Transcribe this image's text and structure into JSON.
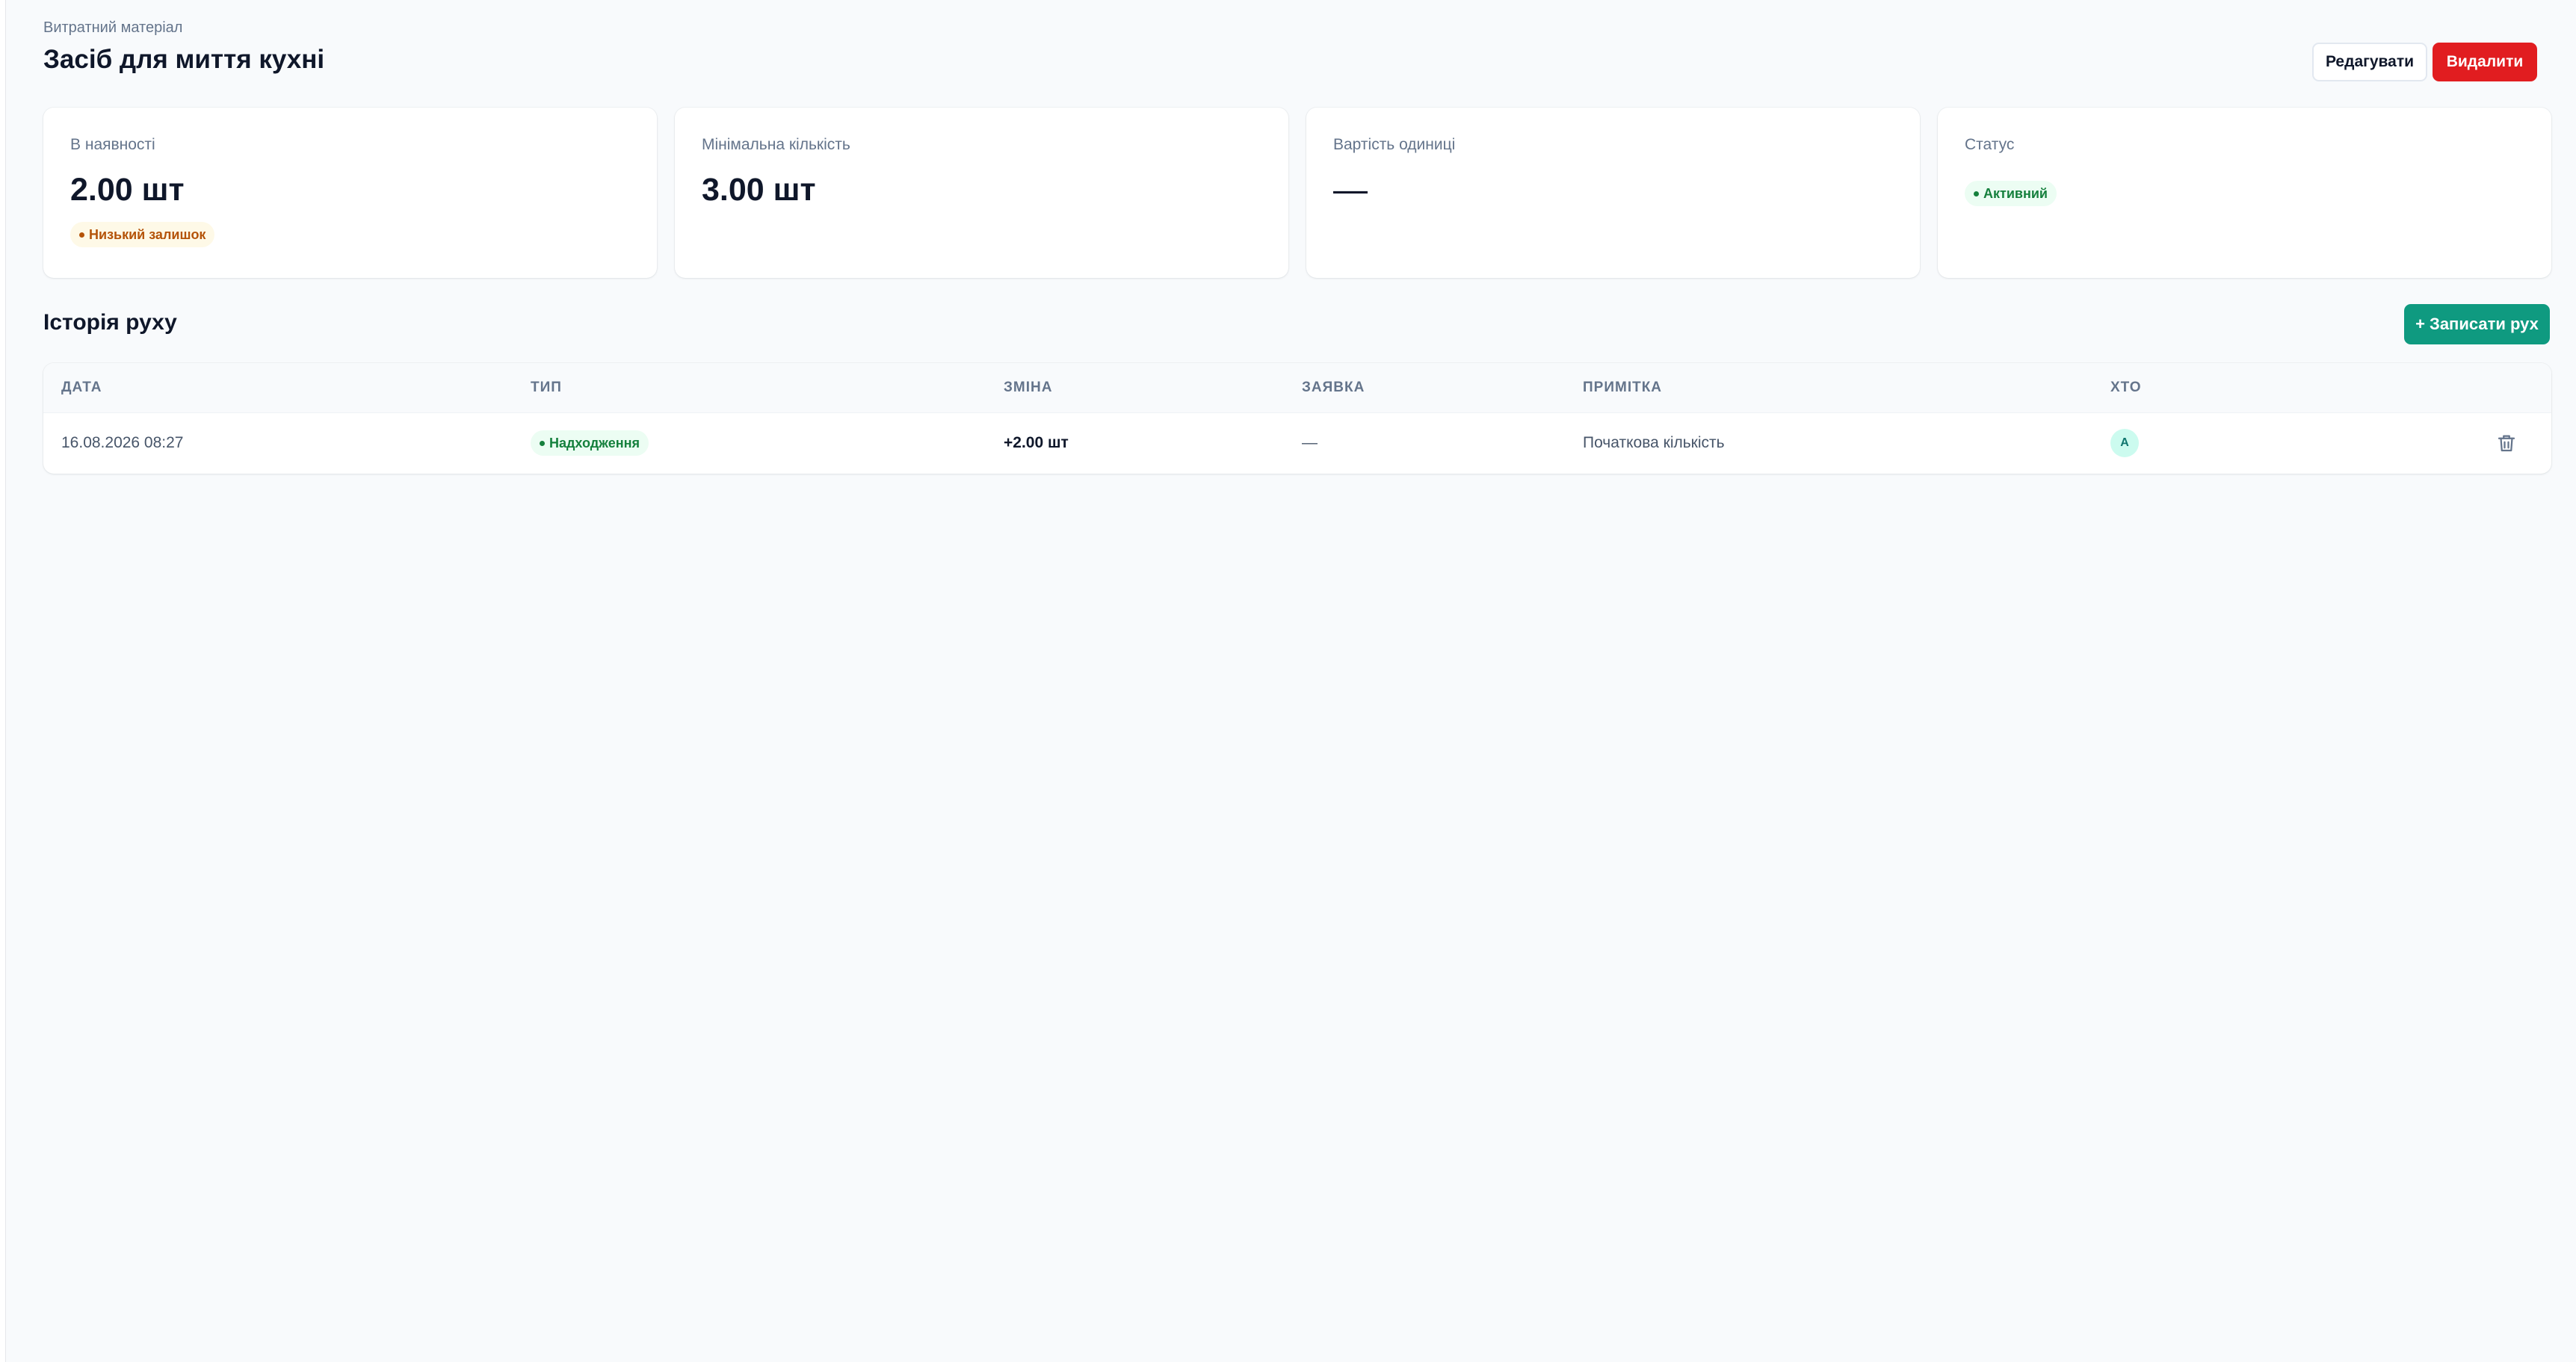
{
  "header": {
    "breadcrumb": "Витратний матеріал",
    "title": "Засіб для миття кухні",
    "edit_label": "Редагувати",
    "delete_label": "Видалити"
  },
  "stats": {
    "in_stock": {
      "label": "В наявності",
      "value": "2.00 шт",
      "badge": "Низький залишок"
    },
    "min_qty": {
      "label": "Мінімальна кількість",
      "value": "3.00 шт"
    },
    "unit_cost": {
      "label": "Вартість одиниці",
      "value": "—"
    },
    "status": {
      "label": "Статус",
      "badge": "Активний"
    }
  },
  "history": {
    "title": "Історія руху",
    "record_label": "+ Записати рух",
    "columns": [
      "ДАТА",
      "ТИП",
      "ЗМІНА",
      "ЗАЯВКА",
      "ПРИМІТКА",
      "ХТО"
    ],
    "rows": [
      {
        "date": "16.08.2026 08:27",
        "type": "Надходження",
        "change": "+2.00 шт",
        "request": "—",
        "note": "Початкова кількість",
        "who_initial": "А"
      }
    ]
  },
  "icons": {
    "delete_row": "trash-icon"
  },
  "colors": {
    "accent": "#0f9a80",
    "danger": "#e11d20",
    "warning": "#b45309",
    "success": "#15803d"
  }
}
